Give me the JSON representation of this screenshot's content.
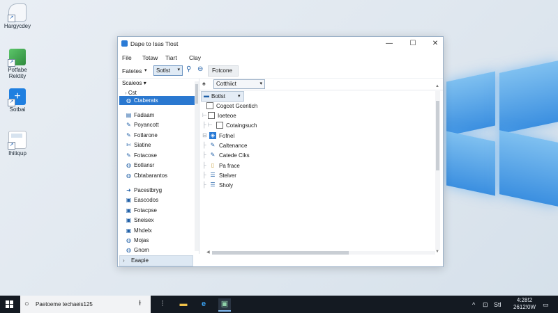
{
  "desktop": {
    "icons": [
      {
        "label": "Hargycdey",
        "icon": "recycle-bin-icon"
      },
      {
        "label": "Potfabe Rektity",
        "icon": "app-shortcut-icon"
      },
      {
        "label": "Sotbai",
        "icon": "blue-plus-app-icon"
      },
      {
        "label": "Ihitiqup",
        "icon": "document-shortcut-icon"
      }
    ]
  },
  "window": {
    "title": "Dape to Isas Tlost",
    "controls": {
      "minimize": "—",
      "maximize": "☐",
      "close": "✕"
    },
    "menu": [
      "File",
      "Totaw",
      "Tiart",
      "Clay"
    ],
    "toolbar": {
      "label": "Fatetes",
      "select_value": "Sotlst",
      "button_label": "Fotcone"
    },
    "left_pane": {
      "header": "Scaieos",
      "parent": "Cst",
      "items": [
        {
          "label": "Ctaberats",
          "icon": "globe-icon",
          "selected": true
        },
        {
          "label": "Fadaam",
          "icon": "folder-icon",
          "selected": false
        },
        {
          "label": "Poyancott",
          "icon": "pen-icon",
          "selected": false
        },
        {
          "label": "Fotlarone",
          "icon": "pen-icon",
          "selected": false
        },
        {
          "label": "Siatine",
          "icon": "tools-icon",
          "selected": false
        },
        {
          "label": "Fotacose",
          "icon": "pen-icon",
          "selected": false
        },
        {
          "label": "Eotlansr",
          "icon": "globe-icon",
          "selected": false
        },
        {
          "label": "Cbtabarantos",
          "icon": "globe-icon",
          "selected": false
        },
        {
          "label": "Pacestbryg",
          "icon": "arrow-right-icon",
          "selected": false
        },
        {
          "label": "Eascodos",
          "icon": "monitor-icon",
          "selected": false
        },
        {
          "label": "Fotacpse",
          "icon": "monitor-icon",
          "selected": false
        },
        {
          "label": "Sneisex",
          "icon": "monitor-icon",
          "selected": false
        },
        {
          "label": "Mhdelx",
          "icon": "monitor-icon",
          "selected": false
        },
        {
          "label": "Mojas",
          "icon": "globe-icon",
          "selected": false
        },
        {
          "label": "Gnom",
          "icon": "globe-icon",
          "selected": false
        }
      ]
    },
    "right_pane": {
      "nav_icon": "bell-icon",
      "dropdown": "Cotthiict",
      "tree": [
        {
          "label": "Botlst",
          "icon": "folder-blue-icon"
        },
        {
          "label": "Cogcet Gcentich",
          "icon": "checkbox-icon"
        },
        {
          "label": "Ioeteoe",
          "icon": "checkbox-icon"
        },
        {
          "label": "Cotaingsuch",
          "icon": "checkbox-icon"
        },
        {
          "label": "Fofnel",
          "icon": "app-blue-icon"
        },
        {
          "label": "Caltenance",
          "icon": "pen-icon"
        },
        {
          "label": "Catede Ciks",
          "icon": "pen-icon"
        },
        {
          "label": "Pa frace",
          "icon": "document-icon"
        },
        {
          "label": "Stelver",
          "icon": "list-icon"
        },
        {
          "label": "Sholy",
          "icon": "list-icon"
        }
      ]
    },
    "status": "Eaapie"
  },
  "taskbar": {
    "search_text": "Paetoeme techaeis125",
    "apps": [
      {
        "name": "task-view",
        "glyph": "⫶"
      },
      {
        "name": "file-explorer",
        "glyph": "▬"
      },
      {
        "name": "edge-browser",
        "glyph": "e"
      },
      {
        "name": "open-window",
        "glyph": "▣"
      }
    ],
    "tray_text": "Stl",
    "clock_time": "4:28!2",
    "clock_date": "2612!0W"
  }
}
